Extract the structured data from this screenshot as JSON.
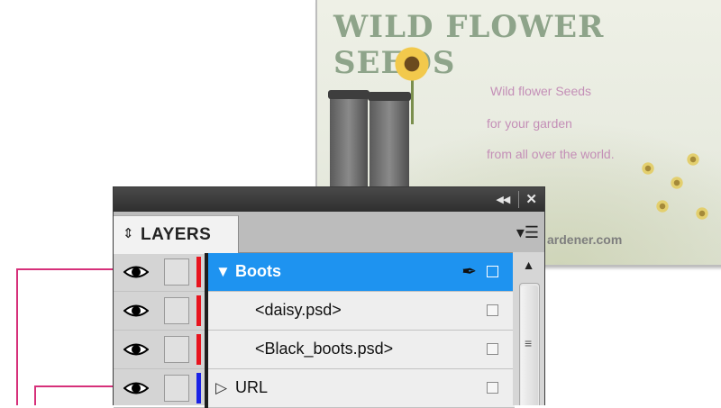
{
  "document": {
    "title": "WILD FLOWER SEEDS",
    "tagline_lines": [
      "Wild flower Seeds",
      "for your garden",
      "from all over the world."
    ],
    "url_fragment": "ardener.com"
  },
  "panel": {
    "tab_label": "LAYERS",
    "tab_icon": "chevron-updown-icon",
    "collapse_icon": "double-left-arrow-icon",
    "close_icon": "close-icon",
    "menu_icon": "panel-menu-icon",
    "layers": [
      {
        "name": "Boots",
        "expanded": true,
        "selected": true,
        "visible": true,
        "color": "#e8141e"
      },
      {
        "name": "<daisy.psd>",
        "child": true,
        "visible": true,
        "color": "#e8141e"
      },
      {
        "name": "<Black_boots.psd>",
        "child": true,
        "visible": true,
        "color": "#e8141e"
      },
      {
        "name": "URL",
        "expanded": false,
        "visible": true,
        "color": "#1a22e6"
      }
    ]
  },
  "colors": {
    "selection": "#1e93f0",
    "connector": "#d6307a",
    "title_green": "#8ea48a",
    "tagline_pink": "#c48fb7"
  }
}
